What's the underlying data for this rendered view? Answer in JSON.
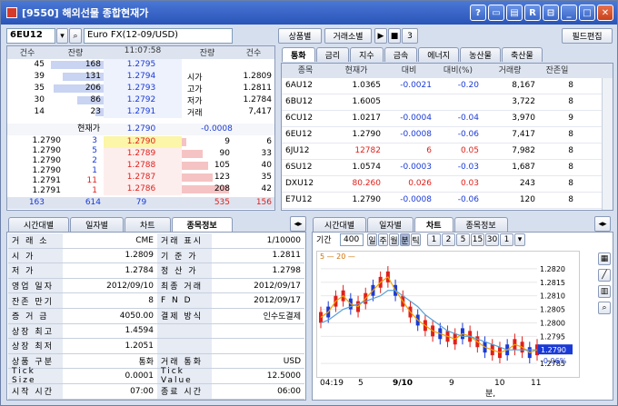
{
  "window": {
    "title": "[9550] 해외선물 종합현재가"
  },
  "toolbar": {
    "symbol_code": "6EU12",
    "symbol_name": "Euro FX(12-09/USD)",
    "btn_by_product": "상품별",
    "btn_by_exchange": "거래소별",
    "play_label": "▶",
    "stop_label": "■",
    "count_label": "3",
    "btn_field_edit": "필드편집"
  },
  "hoga": {
    "headers": [
      "건수",
      "잔량",
      "11:07:58",
      "잔량",
      "건수"
    ],
    "asks": [
      {
        "count": "45",
        "qty": "168",
        "price": "1.2795",
        "bar": 1.0
      },
      {
        "count": "39",
        "qty": "131",
        "price": "1.2794",
        "bar": 0.78
      },
      {
        "count": "35",
        "qty": "206",
        "price": "1.2793",
        "bar": 0.95
      },
      {
        "count": "30",
        "qty": "86",
        "price": "1.2792",
        "bar": 0.5
      },
      {
        "count": "14",
        "qty": "23",
        "price": "1.2791",
        "bar": 0.15
      }
    ],
    "side_info": [
      {
        "label": "시가",
        "value": "1.2809"
      },
      {
        "label": "고가",
        "value": "1.2811"
      },
      {
        "label": "저가",
        "value": "1.2784"
      },
      {
        "label": "거래",
        "value": "7,417"
      }
    ],
    "current_label": "현재가",
    "current_price": "1.2790",
    "current_change": "-0.0008",
    "bids": [
      {
        "price": "1.2790",
        "qty": "9",
        "count": "6",
        "bar": 0.1
      },
      {
        "price": "1.2789",
        "qty": "90",
        "count": "33",
        "bar": 0.45
      },
      {
        "price": "1.2788",
        "qty": "105",
        "count": "40",
        "bar": 0.55
      },
      {
        "price": "1.2787",
        "qty": "123",
        "count": "35",
        "bar": 0.65
      },
      {
        "price": "1.2786",
        "qty": "208",
        "count": "42",
        "bar": 1.0
      }
    ],
    "trades": [
      {
        "price": "1.2790",
        "qty": "3"
      },
      {
        "price": "1.2790",
        "qty": "5"
      },
      {
        "price": "1.2790",
        "qty": "2"
      },
      {
        "price": "1.2790",
        "qty": "1"
      },
      {
        "price": "1.2791",
        "qty": "11"
      },
      {
        "price": "1.2791",
        "qty": "1"
      }
    ],
    "totals": {
      "ask_count": "163",
      "ask_qty": "614",
      "mid": "79",
      "bid_qty": "535",
      "bid_count": "156"
    }
  },
  "market": {
    "tabs": [
      "통화",
      "금리",
      "지수",
      "금속",
      "에너지",
      "농산물",
      "축산물"
    ],
    "headers": [
      "종목",
      "현재가",
      "대비",
      "대비(%)",
      "거래량",
      "잔존일"
    ],
    "rows": [
      {
        "code": "6AU12",
        "price": "1.0365",
        "chg": "-0.0021",
        "pct": "-0.20",
        "vol": "8,167",
        "days": "8",
        "dir": "down"
      },
      {
        "code": "6BU12",
        "price": "1.6005",
        "chg": "",
        "pct": "",
        "vol": "3,722",
        "days": "8",
        "dir": "flat"
      },
      {
        "code": "6CU12",
        "price": "1.0217",
        "chg": "-0.0004",
        "pct": "-0.04",
        "vol": "3,970",
        "days": "9",
        "dir": "down"
      },
      {
        "code": "6EU12",
        "price": "1.2790",
        "chg": "-0.0008",
        "pct": "-0.06",
        "vol": "7,417",
        "days": "8",
        "dir": "down"
      },
      {
        "code": "6JU12",
        "price": "12782",
        "chg": "6",
        "pct": "0.05",
        "vol": "7,982",
        "days": "8",
        "dir": "up"
      },
      {
        "code": "6SU12",
        "price": "1.0574",
        "chg": "-0.0003",
        "pct": "-0.03",
        "vol": "1,687",
        "days": "8",
        "dir": "down"
      },
      {
        "code": "DXU12",
        "price": "80.260",
        "chg": "0.026",
        "pct": "0.03",
        "vol": "243",
        "days": "8",
        "dir": "up"
      },
      {
        "code": "E7U12",
        "price": "1.2790",
        "chg": "-0.0008",
        "pct": "-0.06",
        "vol": "120",
        "days": "8",
        "dir": "down"
      }
    ]
  },
  "info": {
    "tabs": [
      "시간대별",
      "일자별",
      "차트",
      "종목정보"
    ],
    "rows": [
      [
        "거 래 소",
        "CME",
        "거래 표시",
        "1/10000"
      ],
      [
        "시 가",
        "1.2809",
        "기 준 가",
        "1.2811"
      ],
      [
        "저 가",
        "1.2784",
        "정 산 가",
        "1.2798"
      ],
      [
        "영업 일자",
        "2012/09/10",
        "최종 거래",
        "2012/09/17"
      ],
      [
        "잔존 만기",
        "8",
        "F N D",
        "2012/09/17"
      ],
      [
        "증 거 금",
        "4050.00",
        "결제 방식",
        "인수도결제"
      ],
      [
        "상장 최고",
        "1.4594",
        "",
        ""
      ],
      [
        "상장 최저",
        "1.2051",
        "",
        ""
      ],
      [
        "상품 구분",
        "통화",
        "거래 통화",
        "USD"
      ],
      [
        "Tick Size",
        "0.0001",
        "Tick Value",
        "12.5000"
      ],
      [
        "시작 시간",
        "07:00",
        "종료 시간",
        "06:00"
      ]
    ]
  },
  "chart": {
    "tabs": [
      "시간대별",
      "일자별",
      "차트",
      "종목정보"
    ],
    "period_label": "기간",
    "period_value": "400",
    "interval_buttons": [
      "일",
      "주",
      "월",
      "분",
      "틱"
    ],
    "minute_buttons": [
      "1",
      "2",
      "5",
      "15",
      "30",
      "1"
    ],
    "legend": "5 — 20 —",
    "x_labels": [
      "04:19",
      "5",
      "9/10",
      "9",
      "10",
      "11"
    ],
    "y_labels": [
      "1.2820",
      "1.2815",
      "1.2810",
      "1.2805",
      "1.2800",
      "1.2795",
      "1.2785"
    ],
    "last_price": "1.2790",
    "last_pct": "-0.06%",
    "footer": "분,"
  },
  "chart_data": {
    "type": "line",
    "title": "",
    "ylim": [
      1.2782,
      1.2823
    ],
    "series": [
      {
        "name": "5",
        "values": [
          1.2802,
          1.2804,
          1.2808,
          1.281,
          1.2807,
          1.2806,
          1.2809,
          1.2812,
          1.2815,
          1.2817,
          1.2812,
          1.2808,
          1.2804,
          1.2801,
          1.2799,
          1.2797,
          1.2796,
          1.2795,
          1.2794,
          1.2796,
          1.2795,
          1.2793,
          1.2791,
          1.279,
          1.2789,
          1.279,
          1.2792,
          1.2791,
          1.2789,
          1.279
        ]
      },
      {
        "name": "20",
        "values": [
          1.28,
          1.2801,
          1.2803,
          1.2805,
          1.2806,
          1.2807,
          1.2808,
          1.2809,
          1.281,
          1.2812,
          1.2812,
          1.281,
          1.2808,
          1.2806,
          1.2803,
          1.2801,
          1.2799,
          1.2797,
          1.2796,
          1.2795,
          1.2795,
          1.2794,
          1.2793,
          1.2792,
          1.2791,
          1.279,
          1.279,
          1.279,
          1.279,
          1.279
        ]
      }
    ]
  }
}
